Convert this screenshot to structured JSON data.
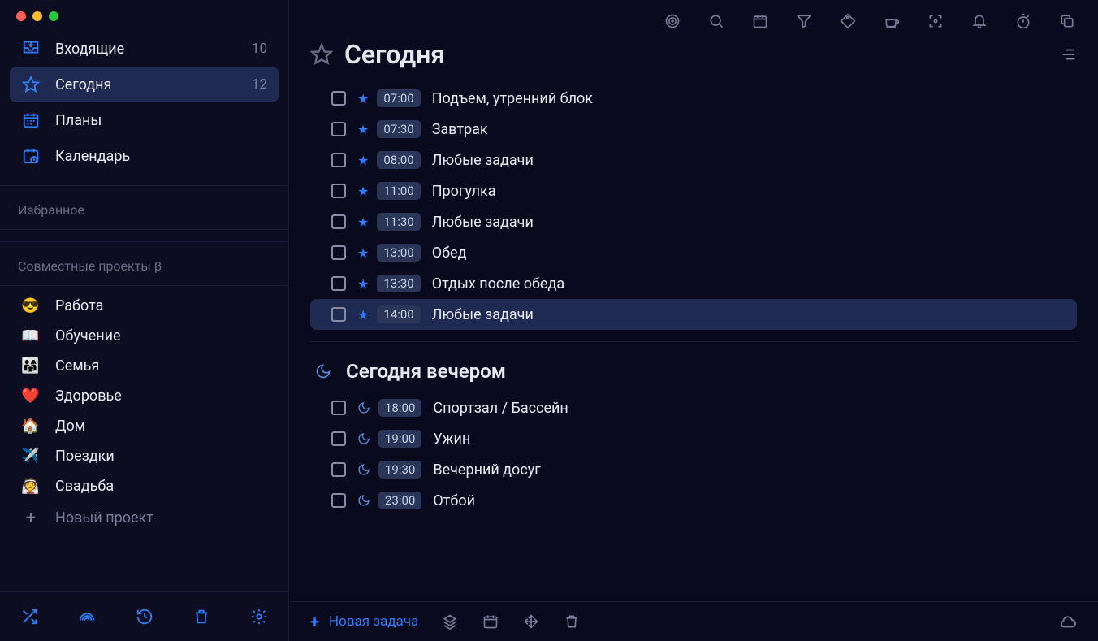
{
  "sidebar": {
    "nav": [
      {
        "icon": "inbox-icon",
        "label": "Входящие",
        "count": "10",
        "active": false
      },
      {
        "icon": "star-icon",
        "label": "Сегодня",
        "count": "12",
        "active": true
      },
      {
        "icon": "calendar-grid-icon",
        "label": "Планы",
        "count": "",
        "active": false
      },
      {
        "icon": "calendar-clock-icon",
        "label": "Календарь",
        "count": "",
        "active": false
      }
    ],
    "favorites_header": "Избранное",
    "shared_header": "Совместные проекты β",
    "projects": [
      {
        "emoji": "😎",
        "label": "Работа"
      },
      {
        "emoji": "📖",
        "label": "Обучение"
      },
      {
        "emoji": "👨‍👩‍👧",
        "label": "Семья"
      },
      {
        "emoji": "❤️",
        "label": "Здоровье"
      },
      {
        "emoji": "🏠",
        "label": "Дом"
      },
      {
        "emoji": "✈️",
        "label": "Поездки"
      },
      {
        "emoji": "👰",
        "label": "Свадьба"
      }
    ],
    "new_project_label": "Новый проект"
  },
  "main": {
    "title": "Сегодня",
    "evening_title": "Сегодня вечером",
    "tasks_day": [
      {
        "time": "07:00",
        "title": "Подъем, утренний блок",
        "selected": false
      },
      {
        "time": "07:30",
        "title": "Завтрак",
        "selected": false
      },
      {
        "time": "08:00",
        "title": "Любые задачи",
        "selected": false
      },
      {
        "time": "11:00",
        "title": "Прогулка",
        "selected": false
      },
      {
        "time": "11:30",
        "title": "Любые задачи",
        "selected": false
      },
      {
        "time": "13:00",
        "title": "Обед",
        "selected": false
      },
      {
        "time": "13:30",
        "title": "Отдых после обеда",
        "selected": false
      },
      {
        "time": "14:00",
        "title": "Любые задачи",
        "selected": true
      }
    ],
    "tasks_evening": [
      {
        "time": "18:00",
        "title": "Спортзал / Бассейн"
      },
      {
        "time": "19:00",
        "title": "Ужин"
      },
      {
        "time": "19:30",
        "title": "Вечерний досуг"
      },
      {
        "time": "23:00",
        "title": "Отбой"
      }
    ],
    "new_task_label": "Новая задача"
  }
}
